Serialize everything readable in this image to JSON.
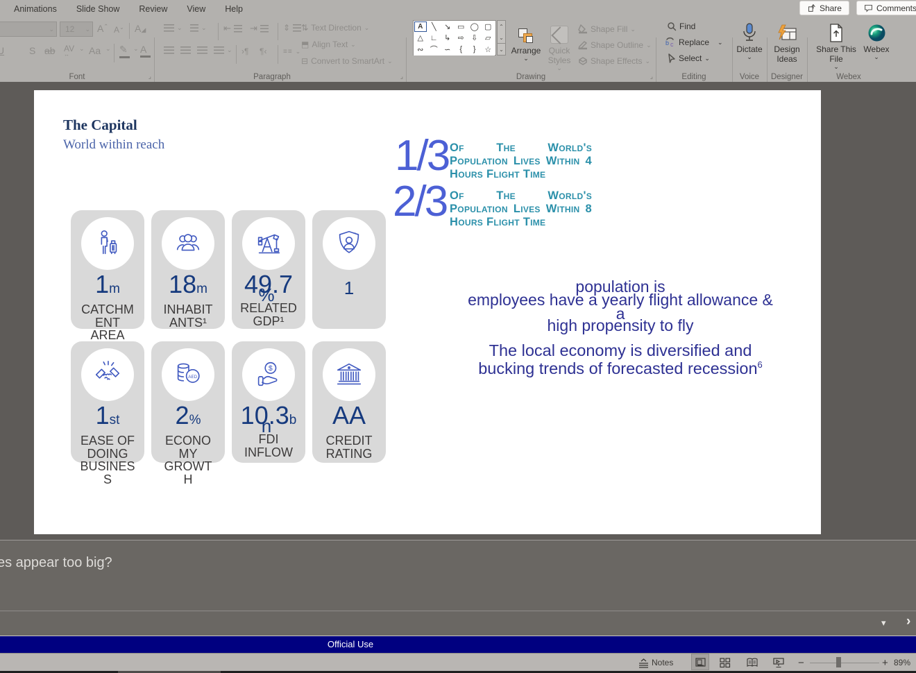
{
  "icons": {
    "chevron_down": "⌄",
    "chevron_up": "⌃",
    "launcher": "⌟",
    "minus": "−",
    "plus": "+",
    "forward_arrow": "›",
    "dropdown_triangle": "▾"
  },
  "ribbon": {
    "tabs": [
      "Animations",
      "Slide Show",
      "Review",
      "View",
      "Help"
    ],
    "share_label": "Share",
    "comments_label": "Comments",
    "font": {
      "label": "Font",
      "size_value": "12",
      "grow": "A",
      "shrink": "A",
      "clear": "A",
      "underline": "U",
      "shadow": "S",
      "strikethrough": "ab",
      "spacing": "AV",
      "case": "Aa"
    },
    "paragraph": {
      "label": "Paragraph",
      "ltr": "›¶",
      "rtl": "¶‹"
    },
    "textdir": {
      "text_direction": "Text Direction",
      "align_text": "Align Text",
      "smartart": "Convert to SmartArt"
    },
    "drawing": {
      "label": "Drawing",
      "arrange": "Arrange",
      "quick_styles": "Quick Styles",
      "shape_fill": "Shape Fill",
      "shape_outline": "Shape Outline",
      "shape_effects": "Shape Effects",
      "shapes": [
        {
          "name": "text-box",
          "glyph": "A"
        },
        {
          "name": "line",
          "glyph": "╲"
        },
        {
          "name": "line-arrow",
          "glyph": "↘"
        },
        {
          "name": "rectangle",
          "glyph": "▭"
        },
        {
          "name": "oval",
          "glyph": "◯"
        },
        {
          "name": "rounded-rectangle",
          "glyph": "▢"
        },
        {
          "name": "triangle",
          "glyph": "△"
        },
        {
          "name": "elbow-connector",
          "glyph": "∟"
        },
        {
          "name": "elbow-arrow-connector",
          "glyph": "↳"
        },
        {
          "name": "right-arrow",
          "glyph": "⇨"
        },
        {
          "name": "down-arrow",
          "glyph": "⇩"
        },
        {
          "name": "flowchart-shape",
          "glyph": "▱"
        },
        {
          "name": "scribble",
          "glyph": "∾"
        },
        {
          "name": "arc",
          "glyph": "⌒"
        },
        {
          "name": "curve",
          "glyph": "∽"
        },
        {
          "name": "left-brace",
          "glyph": "{"
        },
        {
          "name": "right-brace",
          "glyph": "}"
        },
        {
          "name": "star",
          "glyph": "☆"
        }
      ]
    },
    "editing": {
      "label": "Editing",
      "find": "Find",
      "replace": "Replace",
      "select": "Select"
    },
    "voice": {
      "label": "Voice",
      "dictate": "Dictate"
    },
    "designer": {
      "label": "Designer",
      "design_ideas": "Design Ideas"
    },
    "webex": {
      "label": "Webex",
      "share_this_file": "Share This File",
      "webex": "Webex"
    }
  },
  "slide": {
    "title": "The Capital",
    "subtitle": "World within reach",
    "fractions": [
      {
        "value": "1/3",
        "text": "Of The World's Population Lives Within 4 Hours Flight Time"
      },
      {
        "value": "2/3",
        "text": "Of The World's Population Lives Within 8 Hours Flight Time"
      }
    ],
    "center_lines": [
      "population is",
      "employees have a yearly flight allowance &",
      "a",
      "high propensity to fly"
    ],
    "economy_text": "The local economy is diversified and\nbucking trends of forecasted recession",
    "economy_sup": "6",
    "cards": [
      {
        "icon": "traveler-icon",
        "big": "1",
        "small": "m",
        "line2": "",
        "label": "CATCHM\nENT\nAREA"
      },
      {
        "icon": "people-icon",
        "big": "18",
        "small": "m",
        "line2": "",
        "label": "INHABIT\nANTS¹"
      },
      {
        "icon": "oil-pump-icon",
        "big": "49.7",
        "small": "",
        "line2": "%",
        "label": "RELATED\nGDP¹"
      },
      {
        "icon": "shield-person-icon",
        "big": "1",
        "small": "",
        "line2": "",
        "label": ""
      },
      {
        "icon": "handshake-icon",
        "big": "1",
        "small": "st",
        "line2": "",
        "label": "EASE OF\nDOING\nBUSINES\nS"
      },
      {
        "icon": "coins-aed-icon",
        "big": "2",
        "small": "%",
        "line2": "",
        "label": "ECONO\nMY\nGROWT\nH",
        "coin_label": "AED"
      },
      {
        "icon": "hand-money-icon",
        "big": "10.3",
        "small": "b",
        "line2": "n",
        "label": "FDI\nINFLOW",
        "coin_symbol": "$"
      },
      {
        "icon": "bank-icon",
        "big": "AA",
        "small": "",
        "line2": "",
        "label": "CREDIT\nRATING"
      }
    ]
  },
  "notes": {
    "text": "es appear too big?"
  },
  "footer": {
    "official_use": "Official Use"
  },
  "status": {
    "notes_label": "Notes",
    "zoom_value": "89%"
  },
  "colors": {
    "accent_blue": "#4c60d5",
    "teal": "#2b90aa",
    "navy_text": "#2e3193",
    "card_value_navy": "#163a7e",
    "official_bar": "#000080",
    "card_background": "#d9d9d9",
    "icon_blue": "#4059c0"
  }
}
